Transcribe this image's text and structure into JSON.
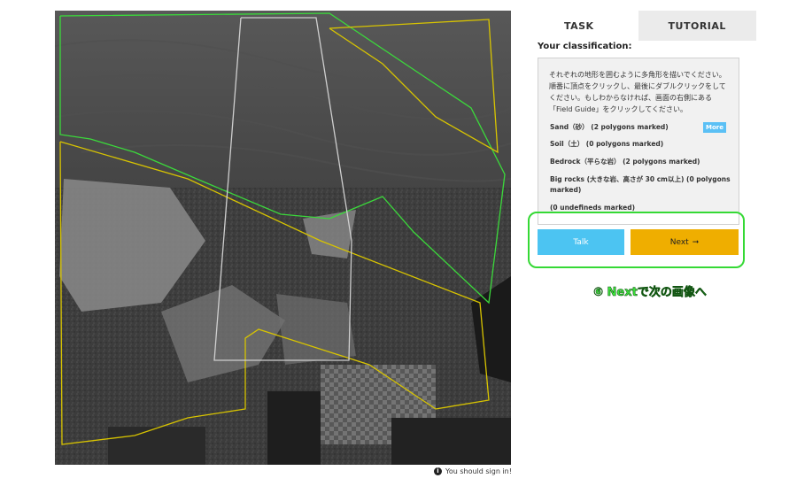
{
  "tabs": {
    "task": "TASK",
    "tutorial": "TUTORIAL"
  },
  "task": {
    "classification_title": "Your classification:",
    "instructions": "それぞれの地形を囲むように多角形を描いでください。順番に頂点をクリックし、最後にダブルクリックをしてください。もしわからなければ、画面の右側にある「Field Guide」をクリックしてください。",
    "tools": {
      "sand": "Sand（砂） (2 polygons marked)",
      "soil": "Soil（土） (0 polygons marked)",
      "bedrock": "Bedrock（平らな岩） (2 polygons marked)",
      "big_rocks": "Big rocks (大きな岩、高さが 30 cm以上) (0 polygons marked)",
      "undefined": "(0 undefineds marked)"
    },
    "more_label": "More",
    "talk_label": "Talk",
    "next_label": "Next",
    "next_arrow": "➞"
  },
  "annotation": "⑥ Nextで次の画像へ",
  "signin": {
    "icon": "i",
    "text": "You should sign in!"
  },
  "colors": {
    "talk": "#4cc4f2",
    "next": "#efae00",
    "more": "#5bc0f5",
    "highlight": "#35d935",
    "polygon_green": "#3bd93b",
    "polygon_yellow": "#d8c400",
    "polygon_white": "#cfcfcf"
  }
}
